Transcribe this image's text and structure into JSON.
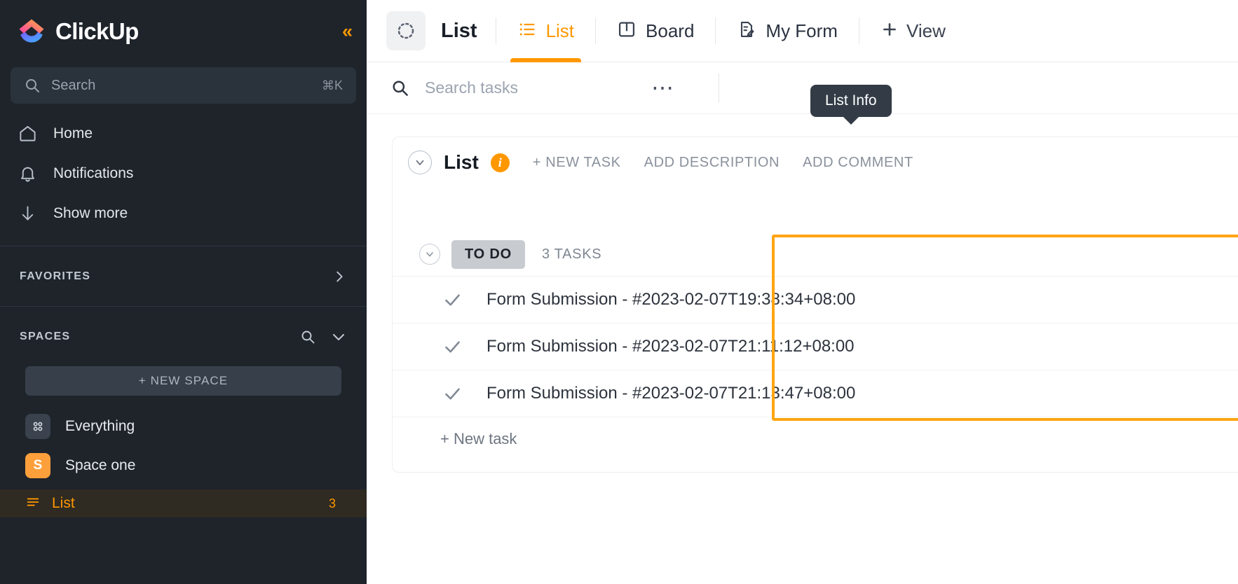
{
  "sidebar": {
    "brand": {
      "name": "ClickUp",
      "logo_icon": "clickup-logo-icon"
    },
    "collapse_icon": "double-chevron-left-icon",
    "search": {
      "placeholder": "Search",
      "shortcut": "⌘K",
      "icon": "search-icon"
    },
    "nav_items": [
      {
        "label": "Home",
        "icon": "home-icon"
      },
      {
        "label": "Notifications",
        "icon": "bell-icon"
      },
      {
        "label": "Show more",
        "icon": "arrow-down-icon"
      }
    ],
    "favorites": {
      "title": "FAVORITES",
      "expand_icon": "chevron-right-icon"
    },
    "spaces": {
      "title": "SPACES",
      "search_icon": "search-icon",
      "collapse_icon": "chevron-down-icon",
      "new_space_label": "+ NEW SPACE",
      "items": [
        {
          "label": "Everything",
          "icon": "grid-dots-icon",
          "avatar": ""
        },
        {
          "label": "Space one",
          "icon": "space-avatar",
          "avatar": "S"
        }
      ],
      "active_list": {
        "label": "List",
        "count": "3",
        "icon": "list-icon"
      }
    }
  },
  "topbar": {
    "breadcrumb_icon": "dotted-circle-icon",
    "breadcrumb_title": "List",
    "tabs": [
      {
        "label": "List",
        "icon": "list-view-icon",
        "active": true
      },
      {
        "label": "Board",
        "icon": "board-view-icon",
        "active": false
      },
      {
        "label": "My Form",
        "icon": "form-view-icon",
        "active": false
      }
    ],
    "add_view": {
      "label": "View",
      "icon": "plus-icon"
    }
  },
  "toolbar": {
    "search_placeholder": "Search tasks",
    "search_icon": "search-icon",
    "more_icon": "ellipsis-icon"
  },
  "tooltip": {
    "text": "List Info"
  },
  "list_header": {
    "collapse_icon": "chevron-down-circle-icon",
    "title": "List",
    "info_badge": "i",
    "actions": [
      "+ NEW TASK",
      "ADD DESCRIPTION",
      "ADD COMMENT"
    ]
  },
  "group": {
    "collapse_icon": "chevron-down-circle-icon",
    "status": "TO DO",
    "task_count": "3 TASKS"
  },
  "tasks": [
    {
      "title": "Form Submission - #2023-02-07T19:38:34+08:00",
      "check_icon": "check-icon"
    },
    {
      "title": "Form Submission - #2023-02-07T21:11:12+08:00",
      "check_icon": "check-icon"
    },
    {
      "title": "Form Submission - #2023-02-07T21:13:47+08:00",
      "check_icon": "check-icon"
    }
  ],
  "new_task": {
    "label": "+ New task"
  },
  "colors": {
    "accent": "#ff9800",
    "highlight": "#ffa512",
    "sidebar_bg": "#1f242b",
    "space_avatar": "#fda03b"
  }
}
